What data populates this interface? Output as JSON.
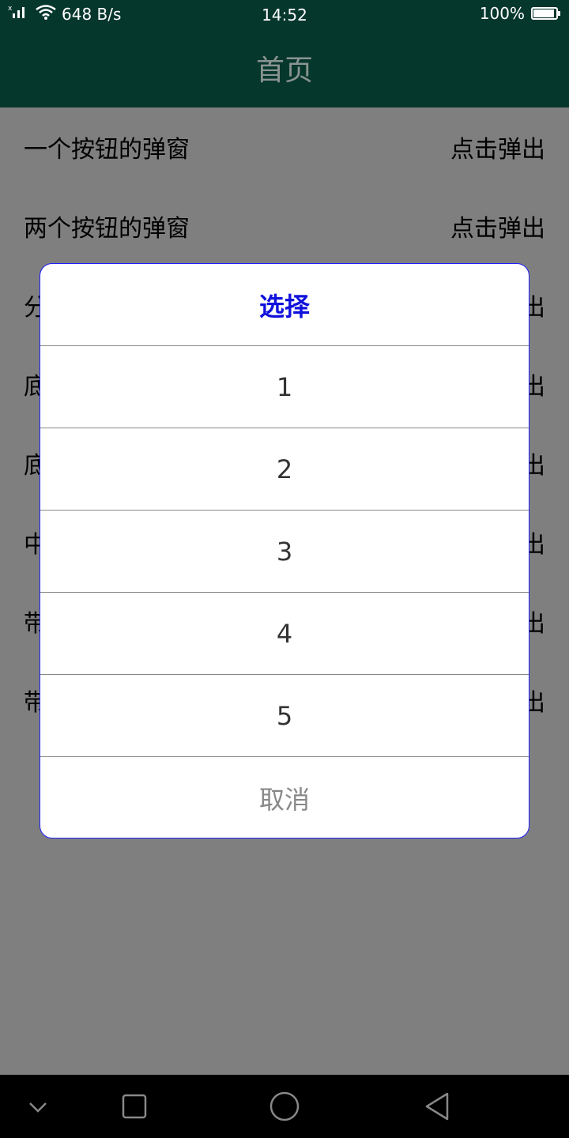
{
  "status_bar": {
    "signal_icon": "signal-icon",
    "wifi_icon": "wifi-icon",
    "speed": "648 B/s",
    "time": "14:52",
    "battery": "100%",
    "battery_level": 1.0
  },
  "app_bar": {
    "title": "首页"
  },
  "list": {
    "items": [
      {
        "label": "一个按钮的弹窗",
        "action": "点击弹出"
      },
      {
        "label": "两个按钮的弹窗",
        "action": "点击弹出"
      },
      {
        "label": "分",
        "action": "出"
      },
      {
        "label": "底",
        "action": "出"
      },
      {
        "label": "底",
        "action": "出"
      },
      {
        "label": "中",
        "action": "出"
      },
      {
        "label": "带",
        "action": "出"
      },
      {
        "label": "带",
        "action": "出"
      }
    ]
  },
  "dialog": {
    "title": "选择",
    "options": [
      "1",
      "2",
      "3",
      "4",
      "5"
    ],
    "cancel": "取消"
  },
  "colors": {
    "app_bar": "#06372d",
    "dialog_title": "#1111dd",
    "dialog_border": "#2020ff"
  },
  "nav_bar": {
    "back_icon": "back-triangle-icon",
    "home_icon": "home-circle-icon",
    "recents_icon": "recents-square-icon",
    "collapse_icon": "chevron-down-icon"
  }
}
